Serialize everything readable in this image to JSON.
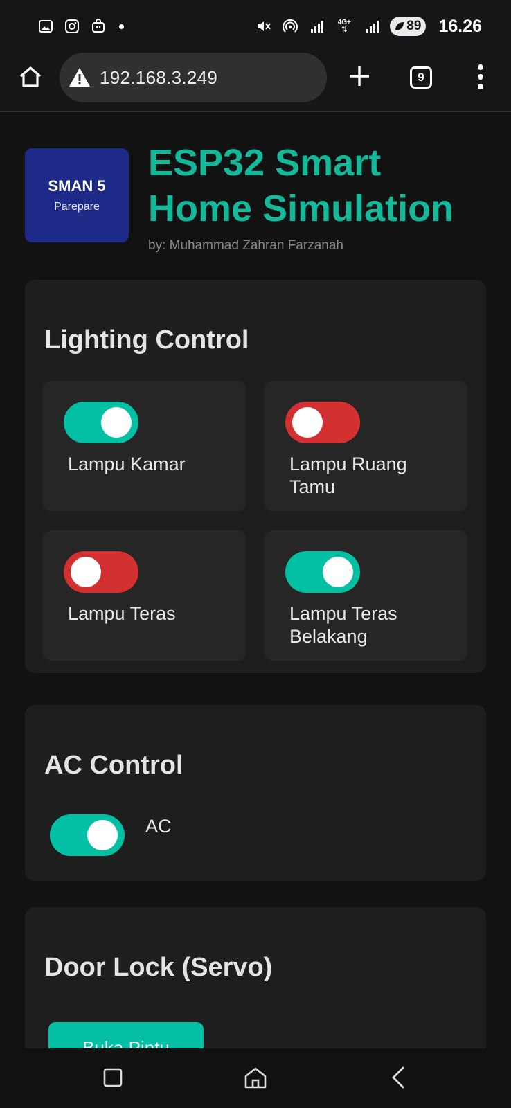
{
  "status_bar": {
    "time": "16.26",
    "battery_level": "89",
    "network_type": "4G+",
    "icons": [
      "gallery-icon",
      "instagram-icon",
      "bag-icon",
      "notification-dot",
      "mute-icon",
      "hotspot-icon",
      "signal-icon",
      "signal-icon"
    ]
  },
  "browser": {
    "url": "192.168.3.249",
    "tab_count": "9",
    "security": "not-secure-warning-icon"
  },
  "header": {
    "logo_title": "SMAN 5",
    "logo_subtitle": "Parepare",
    "title": "ESP32 Smart Home Simulation",
    "byline": "by: Muhammad Zahran Farzanah"
  },
  "lighting": {
    "title": "Lighting Control",
    "items": [
      {
        "label": "Lampu Kamar",
        "on": true
      },
      {
        "label": "Lampu Ruang Tamu",
        "on": false
      },
      {
        "label": "Lampu Teras",
        "on": false
      },
      {
        "label": "Lampu Teras Belakang",
        "on": true
      }
    ]
  },
  "ac": {
    "title": "AC Control",
    "label": "AC",
    "on": true
  },
  "door": {
    "title": "Door Lock (Servo)",
    "button_label": "Buka Pintu"
  },
  "colors": {
    "accent": "#14b89a",
    "switch_on": "#03bfa3",
    "switch_off": "#d33131",
    "logo_bg": "#1e2a87"
  }
}
